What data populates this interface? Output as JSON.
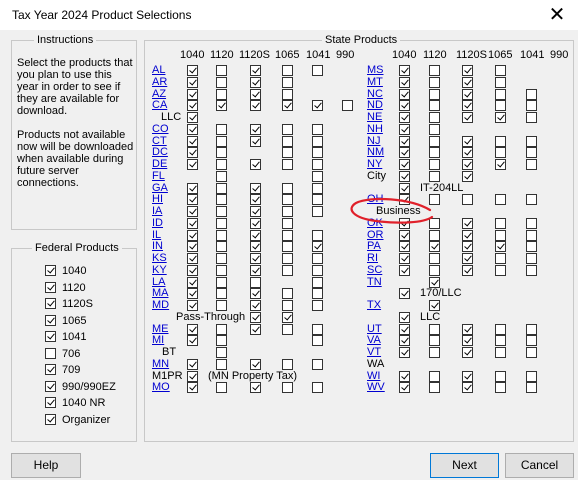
{
  "window": {
    "title": "Tax Year 2024 Product Selections",
    "close_glyph": "✕"
  },
  "instructions": {
    "title": "Instructions",
    "text": "Select the products that you plan to use this year in order to see if they are available for download.\n\nProducts not available now will be downloaded when available during future server connections."
  },
  "federal": {
    "title": "Federal Products",
    "items": [
      {
        "label": "1040",
        "checked": true
      },
      {
        "label": "1120",
        "checked": true
      },
      {
        "label": "1120S",
        "checked": true
      },
      {
        "label": "1065",
        "checked": true
      },
      {
        "label": "1041",
        "checked": true
      },
      {
        "label": "706",
        "checked": false
      },
      {
        "label": "709",
        "checked": true
      },
      {
        "label": "990/990EZ",
        "checked": true
      },
      {
        "label": "1040 NR",
        "checked": true
      },
      {
        "label": "Organizer",
        "checked": true
      }
    ]
  },
  "state": {
    "title": "State Products",
    "columns": [
      "1040",
      "1120",
      "1120S",
      "1065",
      "1041",
      "990"
    ],
    "left": [
      {
        "code": "AL",
        "cells": [
          1,
          0,
          1,
          0,
          0,
          null
        ]
      },
      {
        "code": "AR",
        "cells": [
          1,
          0,
          1,
          0,
          null,
          null
        ]
      },
      {
        "code": "AZ",
        "cells": [
          1,
          0,
          1,
          0,
          null,
          null
        ]
      },
      {
        "code": "CA",
        "cells": [
          1,
          1,
          1,
          1,
          1,
          0
        ]
      },
      {
        "code": "",
        "cells": [
          1,
          null,
          null,
          null,
          null,
          null
        ],
        "sublabel": "LLC"
      },
      {
        "code": "CO",
        "cells": [
          1,
          0,
          1,
          0,
          0,
          null
        ]
      },
      {
        "code": "CT",
        "cells": [
          1,
          0,
          1,
          0,
          0,
          null
        ]
      },
      {
        "code": "DC",
        "cells": [
          1,
          0,
          null,
          0,
          0,
          null
        ]
      },
      {
        "code": "DE",
        "cells": [
          1,
          0,
          1,
          0,
          0,
          null
        ]
      },
      {
        "code": "FL",
        "cells": [
          null,
          0,
          null,
          null,
          0,
          null
        ]
      },
      {
        "code": "GA",
        "cells": [
          1,
          0,
          1,
          0,
          0,
          null
        ]
      },
      {
        "code": "HI",
        "cells": [
          1,
          0,
          1,
          0,
          0,
          null
        ]
      },
      {
        "code": "IA",
        "cells": [
          1,
          0,
          1,
          0,
          0,
          null
        ]
      },
      {
        "code": "ID",
        "cells": [
          1,
          0,
          1,
          0,
          null,
          null
        ]
      },
      {
        "code": "IL",
        "cells": [
          1,
          0,
          1,
          0,
          0,
          null
        ]
      },
      {
        "code": "IN",
        "cells": [
          1,
          0,
          1,
          0,
          1,
          null
        ]
      },
      {
        "code": "KS",
        "cells": [
          1,
          0,
          1,
          0,
          0,
          null
        ]
      },
      {
        "code": "KY",
        "cells": [
          1,
          0,
          1,
          0,
          0,
          null
        ]
      },
      {
        "code": "LA",
        "cells": [
          1,
          0,
          0,
          null,
          0,
          null
        ]
      },
      {
        "code": "MA",
        "cells": [
          1,
          0,
          1,
          0,
          0,
          null
        ]
      },
      {
        "code": "MD",
        "cells": [
          1,
          0,
          1,
          0,
          0,
          null
        ]
      },
      {
        "code": "",
        "cells": [
          null,
          null,
          1,
          1,
          null,
          null
        ],
        "sublabel": "Pass-Through"
      },
      {
        "code": "ME",
        "cells": [
          1,
          0,
          1,
          0,
          0,
          null
        ]
      },
      {
        "code": "MI",
        "cells": [
          1,
          0,
          null,
          null,
          0,
          null
        ]
      },
      {
        "code": "",
        "cells": [
          null,
          0,
          null,
          null,
          null,
          null
        ],
        "sublabel": "BT"
      },
      {
        "code": "MN",
        "cells": [
          1,
          0,
          1,
          0,
          0,
          null
        ]
      },
      {
        "code": "",
        "cells": [
          1,
          null,
          null,
          null,
          null,
          null
        ],
        "sublabel": "M1PR",
        "note": "(MN Property Tax)"
      },
      {
        "code": "MO",
        "cells": [
          1,
          0,
          1,
          0,
          0,
          null
        ]
      }
    ],
    "right": [
      {
        "code": "MS",
        "cells": [
          1,
          0,
          1,
          0,
          null,
          null
        ]
      },
      {
        "code": "MT",
        "cells": [
          1,
          0,
          1,
          0,
          null,
          null
        ]
      },
      {
        "code": "NC",
        "cells": [
          1,
          0,
          1,
          0,
          0,
          null
        ]
      },
      {
        "code": "ND",
        "cells": [
          1,
          0,
          1,
          0,
          0,
          null
        ]
      },
      {
        "code": "NE",
        "cells": [
          1,
          0,
          1,
          1,
          0,
          null
        ]
      },
      {
        "code": "NH",
        "cells": [
          1,
          0,
          null,
          null,
          null,
          null
        ]
      },
      {
        "code": "NJ",
        "cells": [
          1,
          0,
          1,
          0,
          0,
          null
        ]
      },
      {
        "code": "NM",
        "cells": [
          1,
          0,
          1,
          0,
          0,
          null
        ]
      },
      {
        "code": "NY",
        "cells": [
          1,
          0,
          1,
          1,
          0,
          null
        ]
      },
      {
        "code": "",
        "cells": [
          1,
          0,
          1,
          null,
          null,
          null
        ],
        "sublabel": "City"
      },
      {
        "code": "",
        "cells": [
          1,
          null,
          null,
          null,
          null,
          null
        ],
        "note": "IT-204LL"
      },
      {
        "code": "OH",
        "cells": [
          1,
          0,
          0,
          0,
          0,
          null
        ]
      },
      {
        "code": "",
        "cells": [
          null,
          null,
          null,
          null,
          null,
          null
        ],
        "note": "Business"
      },
      {
        "code": "OK",
        "cells": [
          1,
          0,
          1,
          0,
          0,
          null
        ]
      },
      {
        "code": "OR",
        "cells": [
          1,
          0,
          1,
          0,
          0,
          null
        ]
      },
      {
        "code": "PA",
        "cells": [
          1,
          1,
          1,
          1,
          0,
          null
        ]
      },
      {
        "code": "RI",
        "cells": [
          1,
          0,
          1,
          0,
          0,
          null
        ]
      },
      {
        "code": "SC",
        "cells": [
          1,
          0,
          1,
          0,
          0,
          null
        ]
      },
      {
        "code": "TN",
        "cells": [
          null,
          1,
          null,
          null,
          null,
          null
        ]
      },
      {
        "code": "",
        "cells": [
          1,
          null,
          null,
          null,
          null,
          null
        ],
        "note": "170/LLC"
      },
      {
        "code": "TX",
        "cells": [
          null,
          1,
          null,
          null,
          null,
          null
        ]
      },
      {
        "code": "",
        "cells": [
          1,
          null,
          null,
          null,
          null,
          null
        ],
        "note": "LLC"
      },
      {
        "code": "UT",
        "cells": [
          1,
          0,
          1,
          0,
          0,
          null
        ]
      },
      {
        "code": "VA",
        "cells": [
          1,
          0,
          1,
          0,
          0,
          null
        ]
      },
      {
        "code": "VT",
        "cells": [
          1,
          0,
          1,
          0,
          0,
          null
        ]
      },
      {
        "code": "",
        "cells": [
          null,
          null,
          null,
          null,
          null,
          null
        ],
        "sublabel": "WA"
      },
      {
        "code": "WI",
        "cells": [
          1,
          0,
          1,
          0,
          0,
          null
        ]
      },
      {
        "code": "WV",
        "cells": [
          1,
          0,
          1,
          0,
          0,
          null
        ]
      }
    ]
  },
  "buttons": {
    "help": "Help",
    "next": "Next",
    "cancel": "Cancel"
  },
  "annotation": {
    "color": "#e0202a",
    "shape": "hand-drawn-ellipse-around-OH"
  },
  "colors": {
    "link": "#0000d0"
  }
}
